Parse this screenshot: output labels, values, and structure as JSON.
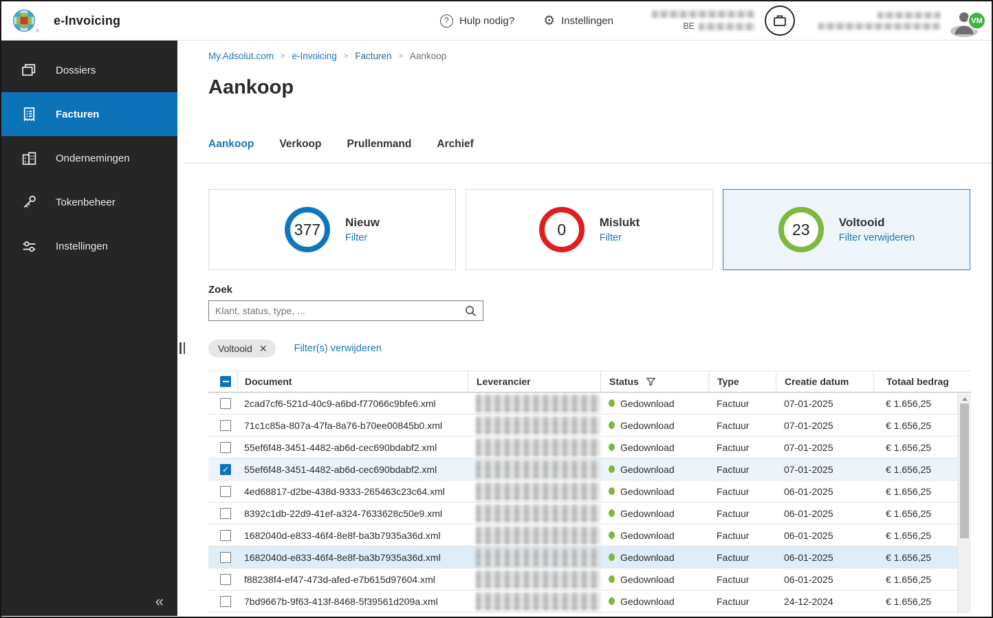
{
  "app": {
    "title": "e-Invoicing",
    "trademark": "®"
  },
  "topbar": {
    "help_label": "Hulp nodig?",
    "settings_label": "Instellingen",
    "vat_prefix": "BE",
    "avatar_badge": "VM"
  },
  "icons": {
    "chip_close": "✕",
    "collapse": "«",
    "breadcrumb_separator": ">",
    "settings_gear": "⚙",
    "help_question": "?",
    "row_check": "✓"
  },
  "colors": {
    "accent": "#0d73b8",
    "link": "#1878b9",
    "ring_blue": "#0f76bd",
    "ring_red": "#e01e1e",
    "ring_green": "#7cb93f",
    "status_dot": "#7fb63d",
    "badge_green": "#43b049"
  },
  "sidebar": {
    "items": [
      {
        "label": "Dossiers",
        "icon": "stacked-folders-icon",
        "active": false
      },
      {
        "label": "Facturen",
        "icon": "invoice-icon",
        "active": true
      },
      {
        "label": "Ondernemingen",
        "icon": "buildings-icon",
        "active": false
      },
      {
        "label": "Tokenbeheer",
        "icon": "key-icon",
        "active": false
      },
      {
        "label": "Instellingen",
        "icon": "sliders-icon",
        "active": false
      }
    ]
  },
  "breadcrumb": [
    "My.Adsolut.com",
    "e-Invoicing",
    "Facturen",
    "Aankoop"
  ],
  "page": {
    "title": "Aankoop"
  },
  "tabs": [
    {
      "label": "Aankoop",
      "active": true
    },
    {
      "label": "Verkoop",
      "active": false
    },
    {
      "label": "Prullenmand",
      "active": false
    },
    {
      "label": "Archief",
      "active": false
    }
  ],
  "status_cards": [
    {
      "count": "377",
      "label": "Nieuw",
      "link_label": "Filter",
      "ring_color": "#0f76bd",
      "selected": false
    },
    {
      "count": "0",
      "label": "Mislukt",
      "link_label": "Filter",
      "ring_color": "#e01e1e",
      "selected": false
    },
    {
      "count": "23",
      "label": "Voltooid",
      "link_label": "Filter verwijderen",
      "ring_color": "#7cb93f",
      "selected": true
    }
  ],
  "search": {
    "label": "Zoek",
    "placeholder": "Klant, status, type, ...",
    "value": ""
  },
  "filters": {
    "chips": [
      "Voltooid"
    ],
    "clear_label": "Filter(s) verwijderen"
  },
  "table": {
    "select_all_state": "indeterminate",
    "status_dot_color": "#7fb63d",
    "columns": [
      {
        "label": "Document"
      },
      {
        "label": "Leverancier"
      },
      {
        "label": "Status",
        "has_filter_icon": true
      },
      {
        "label": "Type"
      },
      {
        "label": "Creatie datum"
      },
      {
        "label": "Totaal bedrag"
      }
    ],
    "rows": [
      {
        "document": "2cad7cf6-521d-40c9-a6bd-f77066c9bfe6.xml",
        "leverancier_redacted": true,
        "status": "Gedownload",
        "type": "Factuur",
        "creatie_datum": "07-01-2025",
        "totaal_bedrag": "€ 1.656,25",
        "checked": false,
        "highlighted": false
      },
      {
        "document": "71c1c85a-807a-47fa-8a76-b70ee00845b0.xml",
        "leverancier_redacted": true,
        "status": "Gedownload",
        "type": "Factuur",
        "creatie_datum": "07-01-2025",
        "totaal_bedrag": "€ 1.656,25",
        "checked": false,
        "highlighted": false
      },
      {
        "document": "55ef6f48-3451-4482-ab6d-cec690bdabf2.xml",
        "leverancier_redacted": true,
        "status": "Gedownload",
        "type": "Factuur",
        "creatie_datum": "07-01-2025",
        "totaal_bedrag": "€ 1.656,25",
        "checked": false,
        "highlighted": false
      },
      {
        "document": "55ef6f48-3451-4482-ab6d-cec690bdabf2.xml",
        "leverancier_redacted": true,
        "status": "Gedownload",
        "type": "Factuur",
        "creatie_datum": "07-01-2025",
        "totaal_bedrag": "€ 1.656,25",
        "checked": true,
        "highlighted": false
      },
      {
        "document": "4ed68817-d2be-438d-9333-265463c23c64.xml",
        "leverancier_redacted": true,
        "status": "Gedownload",
        "type": "Factuur",
        "creatie_datum": "06-01-2025",
        "totaal_bedrag": "€ 1.656,25",
        "checked": false,
        "highlighted": false
      },
      {
        "document": "8392c1db-22d9-41ef-a324-7633628c50e9.xml",
        "leverancier_redacted": true,
        "status": "Gedownload",
        "type": "Factuur",
        "creatie_datum": "06-01-2025",
        "totaal_bedrag": "€ 1.656,25",
        "checked": false,
        "highlighted": false
      },
      {
        "document": "1682040d-e833-46f4-8e8f-ba3b7935a36d.xml",
        "leverancier_redacted": true,
        "status": "Gedownload",
        "type": "Factuur",
        "creatie_datum": "06-01-2025",
        "totaal_bedrag": "€ 1.656,25",
        "checked": false,
        "highlighted": false
      },
      {
        "document": "1682040d-e833-46f4-8e8f-ba3b7935a36d.xml",
        "leverancier_redacted": true,
        "status": "Gedownload",
        "type": "Factuur",
        "creatie_datum": "06-01-2025",
        "totaal_bedrag": "€ 1.656,25",
        "checked": false,
        "highlighted": true
      },
      {
        "document": "f88238f4-ef47-473d-afed-e7b615d97604.xml",
        "leverancier_redacted": true,
        "status": "Gedownload",
        "type": "Factuur",
        "creatie_datum": "06-01-2025",
        "totaal_bedrag": "€ 1.656,25",
        "checked": false,
        "highlighted": false
      },
      {
        "document": "7bd9667b-9f63-413f-8468-5f39561d209a.xml",
        "leverancier_redacted": true,
        "status": "Gedownload",
        "type": "Factuur",
        "creatie_datum": "24-12-2024",
        "totaal_bedrag": "€ 1.656,25",
        "checked": false,
        "highlighted": false
      }
    ]
  }
}
